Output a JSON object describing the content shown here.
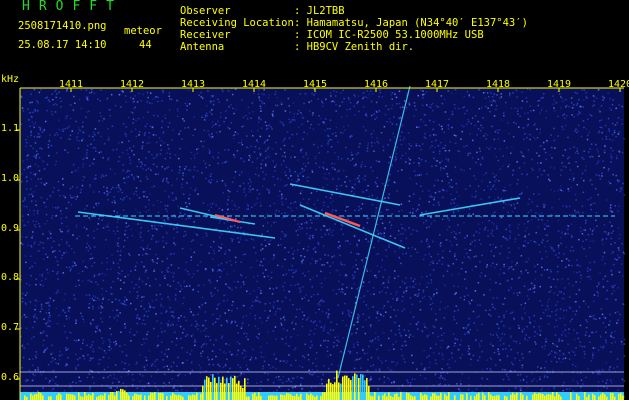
{
  "header": {
    "app_name": "HROFFT",
    "filename": "2508171410.png",
    "timestamp": "25.08.17 14:10",
    "meteor_label": "meteor",
    "meteor_count": "44",
    "rows": [
      {
        "label": "Observer",
        "value": ": JL2TBB"
      },
      {
        "label": "Receiving Location",
        "value": ": Hamamatsu, Japan (N34°40′ E137°43′)"
      },
      {
        "label": "Receiver",
        "value": ": ICOM IC-R2500 53.1000MHz USB"
      },
      {
        "label": "Antenna",
        "value": ": HB9CV Zenith dir."
      }
    ]
  },
  "chart_data": {
    "type": "heatmap",
    "ylabel": "kHz",
    "x_ticks": [
      "1411",
      "1412",
      "1413",
      "1414",
      "1415",
      "1416",
      "1417",
      "1418",
      "1419",
      "1420"
    ],
    "y_ticks": [
      "1.1",
      "1.0",
      "0.9",
      "0.8",
      "0.7",
      "0.6"
    ],
    "colors": {
      "background": "#08105a",
      "noise": "#2a46d8",
      "trace": "#44d8ff",
      "hot": "#ff5a5a",
      "bar": "#ffff00",
      "floor": "#33ccff"
    }
  }
}
